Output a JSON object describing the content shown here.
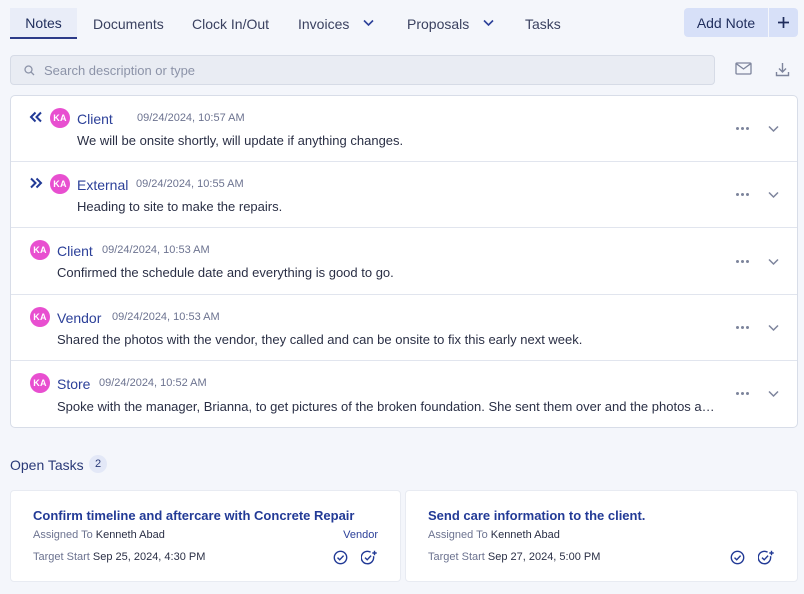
{
  "tabs": [
    {
      "label": "Notes",
      "active": true
    },
    {
      "label": "Documents"
    },
    {
      "label": "Clock In/Out"
    },
    {
      "label": "Invoices",
      "dropdown": true
    },
    {
      "label": "Proposals",
      "dropdown": true
    },
    {
      "label": "Tasks"
    }
  ],
  "toolbar": {
    "add_note_label": "Add Note",
    "add_icon": "plus-icon",
    "email_icon": "mail-icon",
    "download_icon": "download-icon"
  },
  "search": {
    "placeholder": "Search description or type",
    "value": ""
  },
  "notes": [
    {
      "direction": "incoming",
      "initials": "KA",
      "type": "Client",
      "time": "09/24/2024, 10:57 AM",
      "text": "We will be onsite shortly, will update if anything changes."
    },
    {
      "direction": "outgoing",
      "initials": "KA",
      "type": "External",
      "time": "09/24/2024, 10:55 AM",
      "text": "Heading to site to make the repairs."
    },
    {
      "direction": "none",
      "initials": "KA",
      "type": "Client",
      "time": "09/24/2024, 10:53 AM",
      "text": "Confirmed the schedule date and everything is good to go."
    },
    {
      "direction": "none",
      "initials": "KA",
      "type": "Vendor",
      "time": "09/24/2024, 10:53 AM",
      "text": "Shared the photos with the vendor, they called and can be onsite to fix this early next week."
    },
    {
      "direction": "none",
      "initials": "KA",
      "type": "Store",
      "time": "09/24/2024, 10:52 AM",
      "text": "Spoke with the manager, Brianna, to get pictures of the broken foundation. She sent them over and the photos are i..."
    }
  ],
  "open_tasks": {
    "title": "Open Tasks",
    "count": "2",
    "assigned_label": "Assigned To",
    "target_label": "Target Start",
    "items": [
      {
        "title": "Confirm timeline and aftercare with Concrete Repair",
        "assigned_to": "Kenneth Abad",
        "tag": "Vendor",
        "target_start": "Sep 25, 2024, 4:30 PM"
      },
      {
        "title": "Send care information to the client.",
        "assigned_to": "Kenneth Abad",
        "tag": "",
        "target_start": "Sep 27, 2024, 5:00 PM"
      }
    ]
  },
  "colors": {
    "accent": "#2c4099",
    "avatar": "#e84fd0",
    "active_tab_bg": "#e9edf8",
    "add_note_bg": "#d7e0f8"
  }
}
